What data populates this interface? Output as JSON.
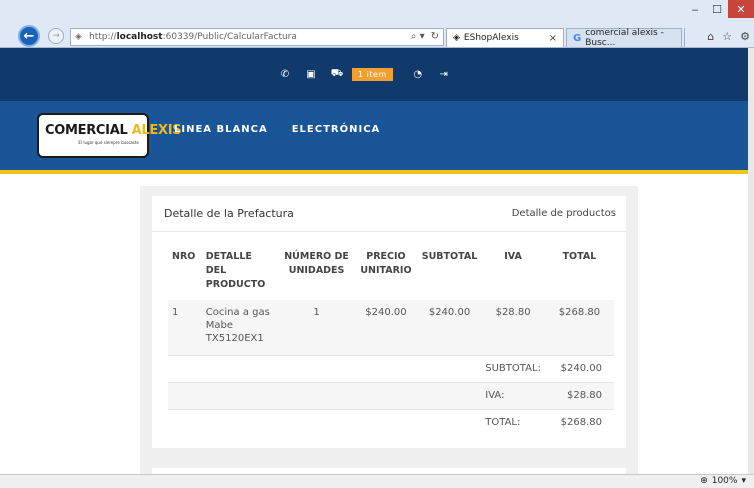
{
  "browser": {
    "url_prefix": "http://",
    "url_host": "localhost",
    "url_rest": ":60339/Public/CalcularFactura",
    "address_tools": [
      "⌕ ▾",
      "↻"
    ],
    "tabs": [
      {
        "label": "EShopAlexis",
        "close": "×"
      },
      {
        "label": "comercial alexis - Busc..."
      }
    ],
    "zoom": "100%"
  },
  "topbar": {
    "cart_badge": "1 item"
  },
  "logo": {
    "main_left": "COMERCIAL ",
    "main_accent": "ALEXIS",
    "tagline": "El lugar que siempre buscaste",
    "accent_color": "#f0b81a"
  },
  "nav": {
    "items": [
      "LINEA BLANCA",
      "ELECTRÓNICA"
    ]
  },
  "panel": {
    "title": "Detalle de la Prefactura",
    "link": "Detalle de productos"
  },
  "table": {
    "headers": {
      "nro": "NRO",
      "producto": "DETALLE DEL PRODUCTO",
      "unidades": "NÚMERO DE UNIDADES",
      "precio": "PRECIO UNITARIO",
      "subtotal": "SUBTOTAL",
      "iva": "IVA",
      "total": "TOTAL"
    },
    "rows": [
      {
        "nro": "1",
        "producto": "Cocina a gas Mabe TX5120EX1",
        "unidades": "1",
        "precio": "$240.00",
        "subtotal": "$240.00",
        "iva": "$28.80",
        "total": "$268.80"
      }
    ],
    "summary": {
      "subtotal_label": "SUBTOTAL:",
      "subtotal_value": "$240.00",
      "iva_label": "IVA:",
      "iva_value": "$28.80",
      "total_label": "TOTAL:",
      "total_value": "$268.80"
    }
  },
  "colors": {
    "topbar": "#0f3a6b",
    "nav": "#1a5597",
    "stripe": "#f0c419",
    "badge": "#f0a030"
  }
}
